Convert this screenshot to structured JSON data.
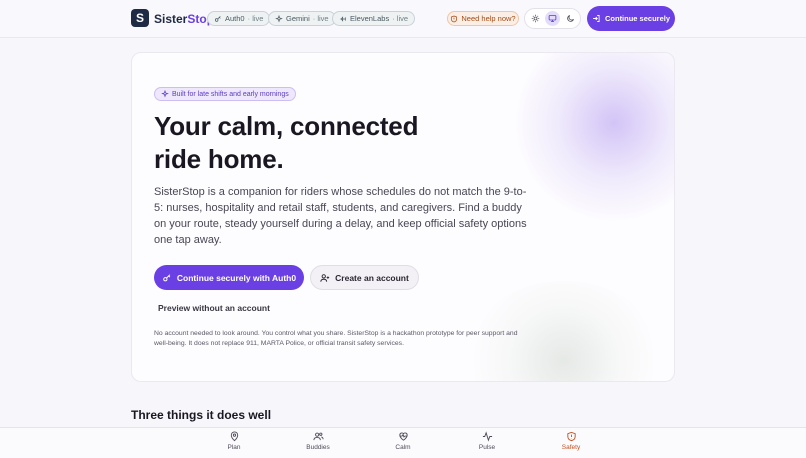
{
  "header": {
    "logo_letter": "S",
    "brand_main": "Sister",
    "brand_accent": "Stop",
    "pills": [
      {
        "name": "Auth0",
        "status": "· live",
        "icon": "key-icon"
      },
      {
        "name": "Gemini",
        "status": "· live",
        "icon": "sparkle-icon"
      },
      {
        "name": "ElevenLabs",
        "status": "· live",
        "icon": "audio-icon"
      }
    ],
    "help_label": "Need help now?",
    "theme_options": [
      "light",
      "system",
      "dark"
    ],
    "theme_selected": "system",
    "cta_label": "Continue securely"
  },
  "hero": {
    "tagline": "Built for late shifts and early mornings",
    "title_line1": "Your calm, connected",
    "title_line2": "ride home.",
    "description": "SisterStop is a companion for riders whose schedules do not match the 9-to-5: nurses, hospitality and retail staff, students, and caregivers. Find a buddy on your route, steady yourself during a delay, and keep official safety options one tap away.",
    "primary_button": "Continue securely with Auth0",
    "secondary_button": "Create an account",
    "preview_link": "Preview without an account",
    "disclaimer": "No account needed to look around. You control what you share. SisterStop is a hackathon prototype for peer support and well-being. It does not replace 911, MARTA Police, or official transit safety services."
  },
  "section": {
    "title": "Three things it does well"
  },
  "nav": {
    "items": [
      {
        "label": "Plan",
        "icon": "map-pin-icon"
      },
      {
        "label": "Buddies",
        "icon": "users-icon"
      },
      {
        "label": "Calm",
        "icon": "heart-pulse-icon"
      },
      {
        "label": "Pulse",
        "icon": "activity-icon"
      },
      {
        "label": "Safety",
        "icon": "shield-icon"
      }
    ],
    "accent_color": "#c2501d"
  },
  "colors": {
    "primary": "#6a3fe3",
    "help": "#a24d1a"
  }
}
